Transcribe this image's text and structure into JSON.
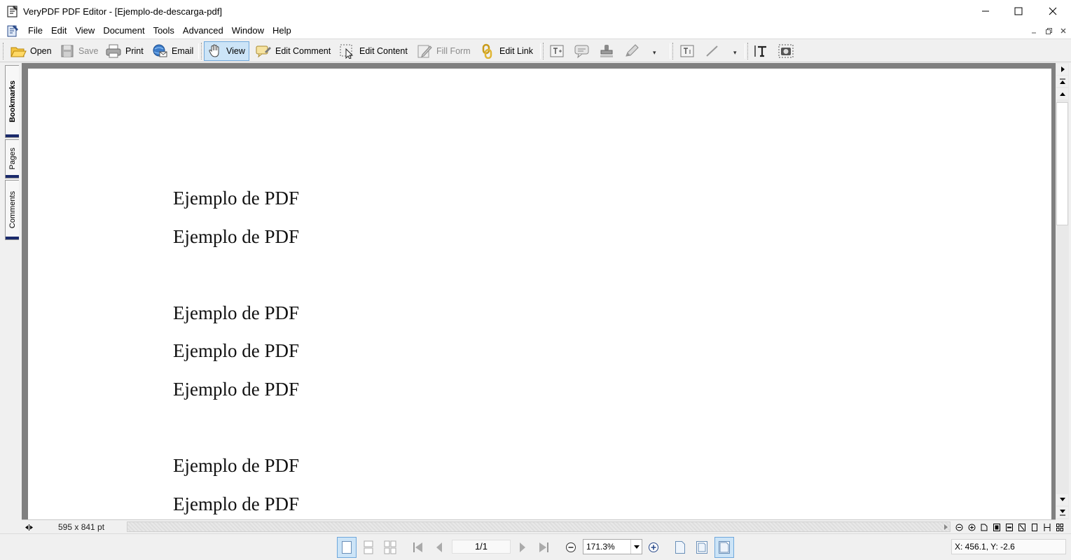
{
  "window": {
    "title": "VeryPDF PDF Editor - [Ejemplo-de-descarga-pdf]",
    "controls": [
      "minimize",
      "maximize",
      "close"
    ]
  },
  "menu": {
    "items": [
      "File",
      "Edit",
      "View",
      "Document",
      "Tools",
      "Advanced",
      "Window",
      "Help"
    ]
  },
  "toolbar": {
    "open": "Open",
    "save": "Save",
    "print": "Print",
    "email": "Email",
    "view": "View",
    "edit_comment": "Edit Comment",
    "edit_content": "Edit Content",
    "fill_form": "Fill Form",
    "edit_link": "Edit Link",
    "active_tool": "View"
  },
  "sidebar": {
    "tabs": [
      "Bookmarks",
      "Pages",
      "Comments"
    ]
  },
  "document": {
    "lines": [
      "Ejemplo de PDF",
      "Ejemplo de PDF",
      "Ejemplo de PDF",
      "Ejemplo de PDF",
      "Ejemplo de PDF",
      "Ejemplo de PDF",
      "Ejemplo de PDF"
    ]
  },
  "status": {
    "page_size": "595 x 841 pt",
    "page_indicator": "1/1",
    "zoom": "171.3%",
    "coordinates": "X: 456.1, Y: -2.6"
  },
  "colors": {
    "accent": "#cce4f7",
    "accent_border": "#6fa8dc",
    "workspace": "#808080",
    "sidetab_bar": "#1a2a6b"
  }
}
